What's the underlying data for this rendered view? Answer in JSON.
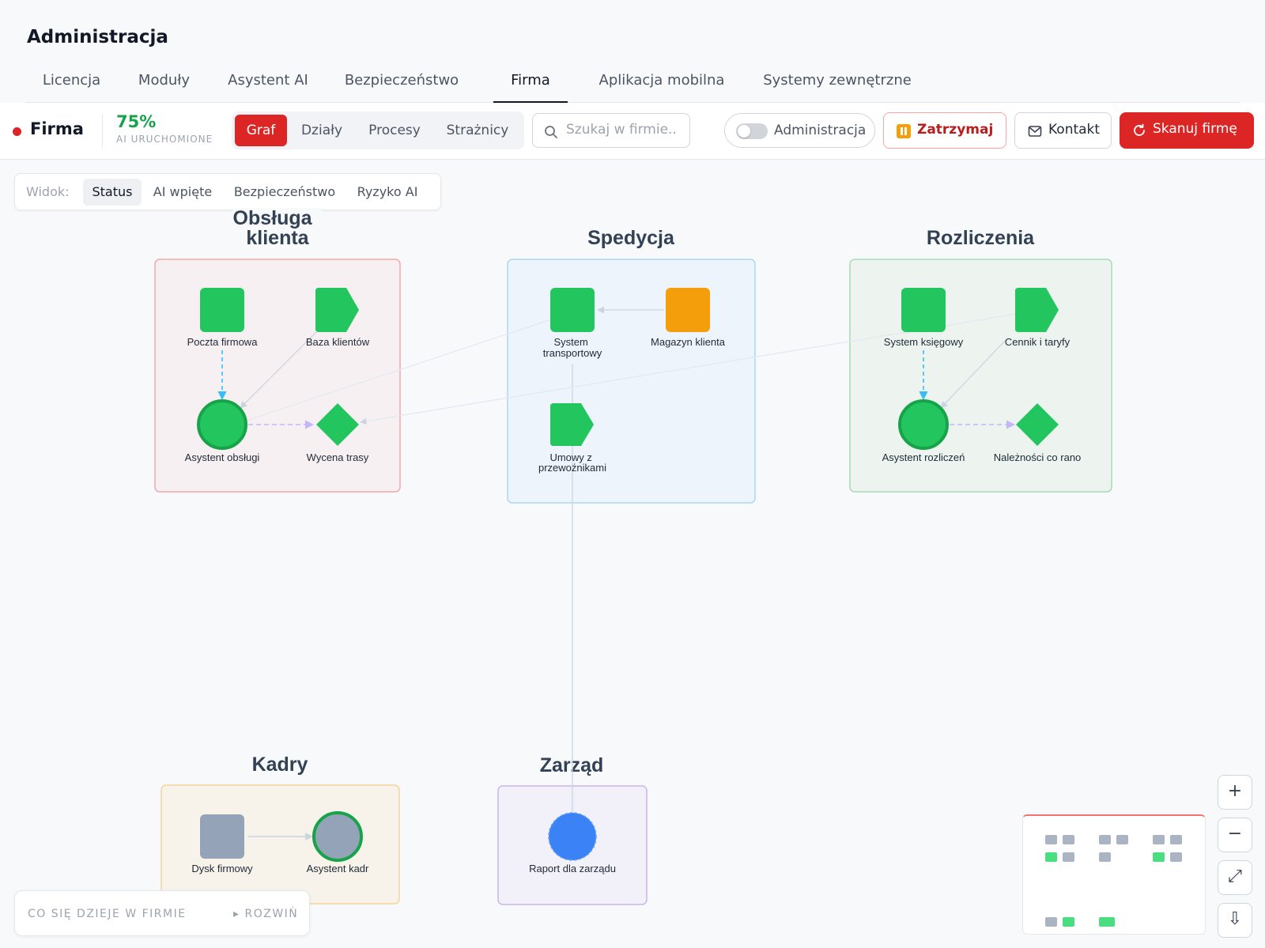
{
  "page": {
    "title": "Administracja"
  },
  "tabs": [
    {
      "label": "Licencja"
    },
    {
      "label": "Moduły"
    },
    {
      "label": "Asystent AI"
    },
    {
      "label": "Bezpieczeństwo"
    },
    {
      "label": "Firma"
    },
    {
      "label": "Aplikacja mobilna"
    },
    {
      "label": "Systemy zewnętrzne"
    }
  ],
  "active_tab": "Firma",
  "toolbar": {
    "firm_label": "Firma",
    "ai_percent": "75%",
    "ai_status_label": "AI URUCHOMIONE",
    "views": [
      {
        "label": "Graf"
      },
      {
        "label": "Działy"
      },
      {
        "label": "Procesy"
      },
      {
        "label": "Strażnicy"
      }
    ],
    "active_view": "Graf",
    "search": {
      "placeholder": "Szukaj w firmie..",
      "value": ""
    },
    "admin_toggle": {
      "label": "Administracja",
      "on": false
    },
    "pause_label": "Zatrzymaj",
    "contact_label": "Kontakt",
    "scan_label": "Skanuj firmę"
  },
  "view_filter": {
    "label": "Widok:",
    "options": [
      {
        "label": "Status"
      },
      {
        "label": "AI wpięte"
      },
      {
        "label": "Bezpieczeństwo"
      },
      {
        "label": "Ryzyko AI"
      }
    ],
    "active": "Status"
  },
  "colors": {
    "accent_red": "#dc2626",
    "ok_green": "#22c55e",
    "warn_orange": "#f59e0b",
    "inactive_gray": "#94a3b8",
    "report_blue": "#3b82f6"
  },
  "groups": [
    {
      "title_lines": [
        "Obsługa",
        "klienta"
      ]
    },
    {
      "title_lines": [
        "Spedycja"
      ]
    },
    {
      "title_lines": [
        "Rozliczenia"
      ]
    },
    {
      "title_lines": [
        "Kadry"
      ]
    },
    {
      "title_lines": [
        "Zarząd"
      ]
    }
  ],
  "nodes": {
    "poczta": {
      "label_lines": [
        "Poczta firmowa"
      ],
      "shape": "square",
      "status": "ok"
    },
    "baza": {
      "label_lines": [
        "Baza klientów"
      ],
      "shape": "tag",
      "status": "ok"
    },
    "asystent_obslugi": {
      "label_lines": [
        "Asystent obsługi"
      ],
      "shape": "circle",
      "status": "ok"
    },
    "wycena": {
      "label_lines": [
        "Wycena trasy"
      ],
      "shape": "diamond",
      "status": "ok"
    },
    "system_transportowy": {
      "label_lines": [
        "System",
        "transportowy"
      ],
      "shape": "square",
      "status": "ok"
    },
    "magazyn": {
      "label_lines": [
        "Magazyn klienta"
      ],
      "shape": "square",
      "status": "warning"
    },
    "umowy": {
      "label_lines": [
        "Umowy z",
        "przewoźnikami"
      ],
      "shape": "tag",
      "status": "ok"
    },
    "system_ksiegowy": {
      "label_lines": [
        "System księgowy"
      ],
      "shape": "square",
      "status": "ok"
    },
    "cennik": {
      "label_lines": [
        "Cennik i taryfy"
      ],
      "shape": "tag",
      "status": "ok"
    },
    "asystent_rozliczen": {
      "label_lines": [
        "Asystent rozliczeń"
      ],
      "shape": "circle",
      "status": "ok"
    },
    "naleznosci": {
      "label_lines": [
        "Należności co rano"
      ],
      "shape": "diamond",
      "status": "ok"
    },
    "dysk": {
      "label_lines": [
        "Dysk firmowy"
      ],
      "shape": "square",
      "status": "inactive"
    },
    "asystent_kadr": {
      "label_lines": [
        "Asystent kadr"
      ],
      "shape": "circle",
      "status": "inactive"
    },
    "raport": {
      "label_lines": [
        "Raport dla zarządu"
      ],
      "shape": "circle",
      "status": "report"
    }
  },
  "zoom_controls": [
    {
      "name": "zoom-in",
      "glyph": "+"
    },
    {
      "name": "zoom-out",
      "glyph": "−"
    },
    {
      "name": "fit-view",
      "glyph": "⤢"
    },
    {
      "name": "export",
      "glyph": "⇩"
    }
  ],
  "feed": {
    "title": "CO SIĘ DZIEJE W FIRMIE",
    "expand_label": "▸ ROZWIŃ"
  }
}
